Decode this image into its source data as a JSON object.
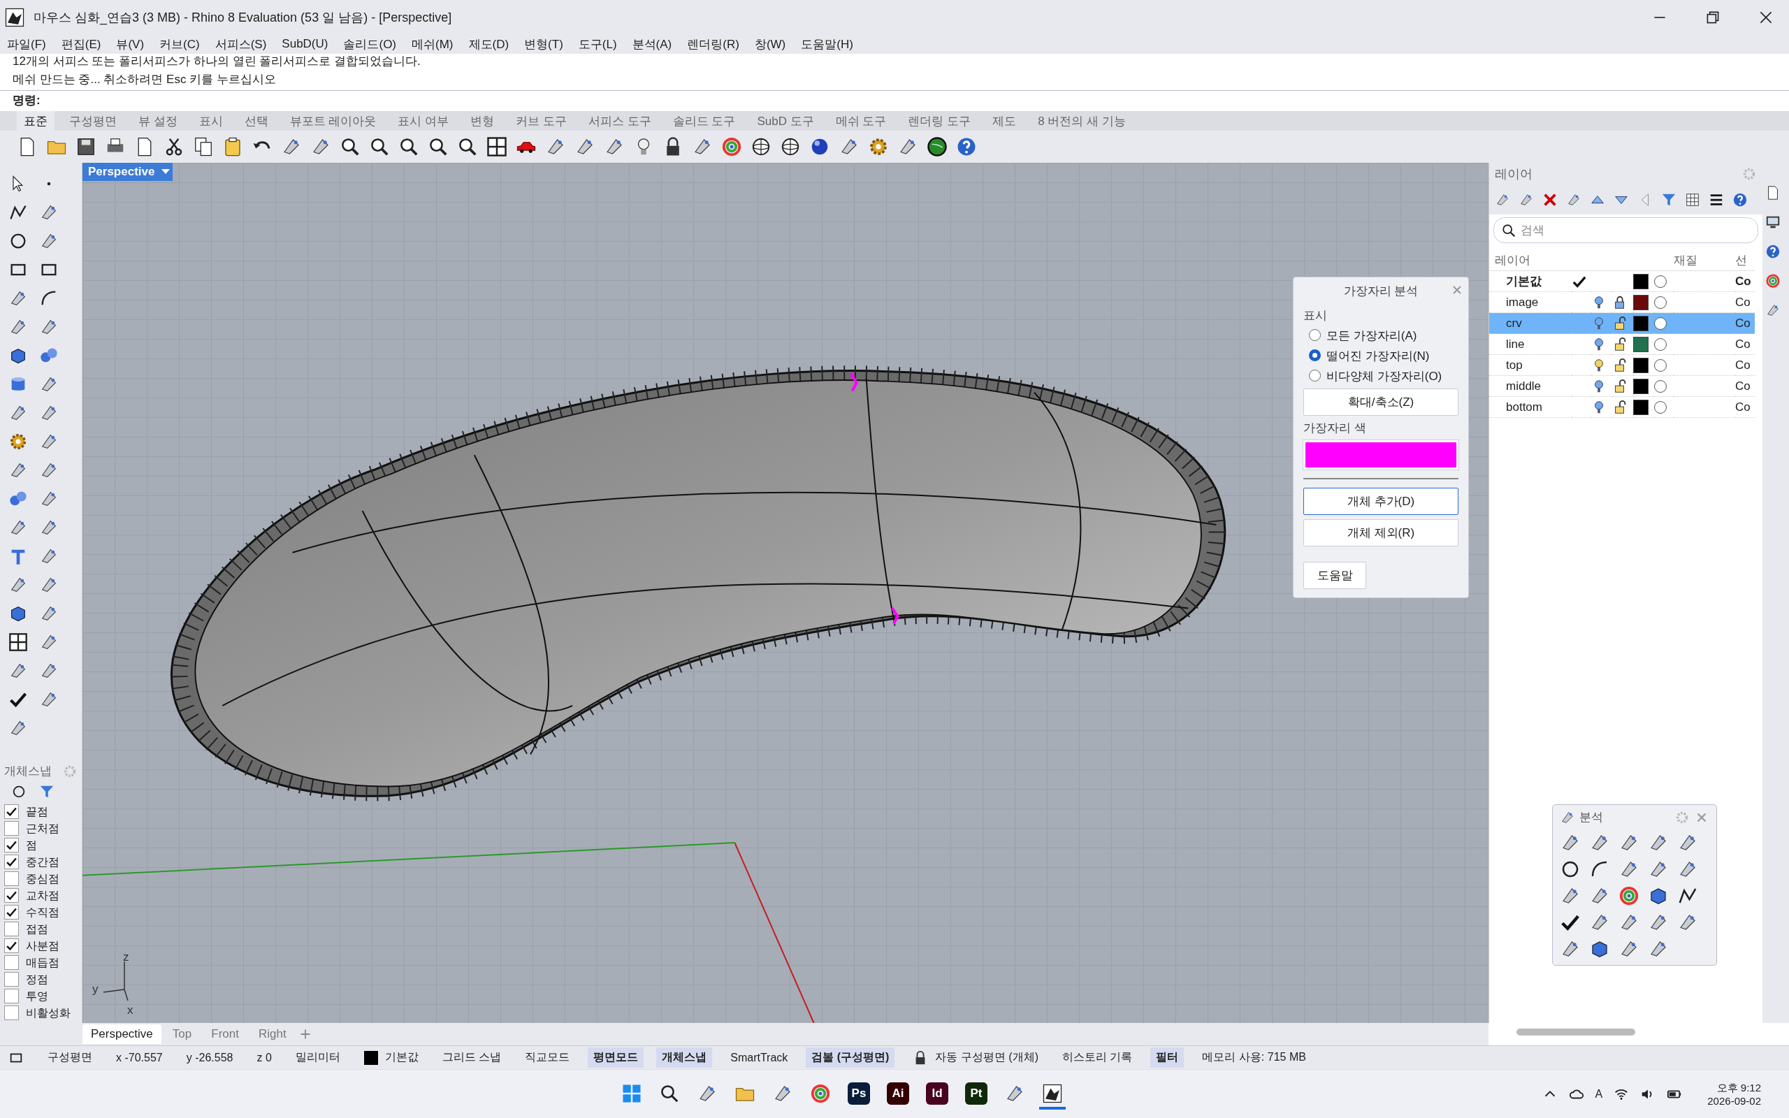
{
  "window": {
    "title": "마우스 심화_연습3 (3 MB) - Rhino 8 Evaluation (53 일 남음) - [Perspective]"
  },
  "menu": [
    "파일(F)",
    "편집(E)",
    "뷰(V)",
    "커브(C)",
    "서피스(S)",
    "SubD(U)",
    "솔리드(O)",
    "메쉬(M)",
    "제도(D)",
    "변형(T)",
    "도구(L)",
    "분석(A)",
    "렌더링(R)",
    "창(W)",
    "도움말(H)"
  ],
  "command": {
    "history": [
      "12개의 서피스 또는 폴리서피스가 하나의 열린 폴리서피스로 결합되었습니다.",
      "메쉬 만드는 중... 취소하려면 Esc 키를 누르십시오"
    ],
    "prompt": "명령:"
  },
  "toolbar_tabs": [
    {
      "label": "표준",
      "selected": true
    },
    {
      "label": "구성평면",
      "selected": false
    },
    {
      "label": "뷰 설정",
      "selected": false
    },
    {
      "label": "표시",
      "selected": false
    },
    {
      "label": "선택",
      "selected": false
    },
    {
      "label": "뷰포트 레이아웃",
      "selected": false
    },
    {
      "label": "표시 여부",
      "selected": false
    },
    {
      "label": "변형",
      "selected": false
    },
    {
      "label": "커브 도구",
      "selected": false
    },
    {
      "label": "서피스 도구",
      "selected": false
    },
    {
      "label": "솔리드 도구",
      "selected": false
    },
    {
      "label": "SubD 도구",
      "selected": false
    },
    {
      "label": "메쉬 도구",
      "selected": false
    },
    {
      "label": "렌더링 도구",
      "selected": false
    },
    {
      "label": "제도",
      "selected": false
    },
    {
      "label": "8 버전의 새 기능",
      "selected": false
    }
  ],
  "viewport": {
    "title": "Perspective",
    "axes": [
      "z",
      "y",
      "x"
    ]
  },
  "edge_analysis": {
    "title": "가장자리 분석",
    "display_label": "표시",
    "options": [
      {
        "label": "모든 가장자리(A)",
        "selected": false
      },
      {
        "label": "떨어진 가장자리(N)",
        "selected": true
      },
      {
        "label": "비다양체 가장자리(O)",
        "selected": false
      }
    ],
    "zoom_button": "확대/축소(Z)",
    "color_label": "가장자리 색",
    "color": "#ff00ff",
    "buttons": [
      "개체 추가(D)",
      "개체 제외(R)"
    ],
    "help_button": "도움말"
  },
  "snap_panel": {
    "title": "개체스냅",
    "items": [
      {
        "label": "끝점",
        "checked": true
      },
      {
        "label": "근처점",
        "checked": false
      },
      {
        "label": "점",
        "checked": true
      },
      {
        "label": "중간점",
        "checked": true
      },
      {
        "label": "중심점",
        "checked": false
      },
      {
        "label": "교차점",
        "checked": true
      },
      {
        "label": "수직점",
        "checked": true
      },
      {
        "label": "접점",
        "checked": false
      },
      {
        "label": "사분점",
        "checked": true
      },
      {
        "label": "매듭점",
        "checked": false
      },
      {
        "label": "정점",
        "checked": false
      },
      {
        "label": "투영",
        "checked": false
      },
      {
        "label": "비활성화",
        "checked": false
      }
    ]
  },
  "layers": {
    "title": "레이어",
    "search_placeholder": "검색",
    "columns": [
      "레이어",
      "재질",
      "선"
    ],
    "rows": [
      {
        "name": "기본값",
        "current": true,
        "selected": false,
        "color": "#000000",
        "linetype": "Co"
      },
      {
        "name": "image",
        "current": false,
        "selected": false,
        "light_on": false,
        "locked": true,
        "color": "#6b0a0a",
        "linetype": "Co"
      },
      {
        "name": "crv",
        "current": false,
        "selected": true,
        "light_on": false,
        "locked": false,
        "color": "#000000",
        "linetype": "Co"
      },
      {
        "name": "line",
        "current": false,
        "selected": false,
        "light_on": false,
        "locked": false,
        "color": "#21704e",
        "linetype": "Co"
      },
      {
        "name": "top",
        "current": false,
        "selected": false,
        "light_on": true,
        "locked": false,
        "color": "#000000",
        "linetype": "Co"
      },
      {
        "name": "middle",
        "current": false,
        "selected": false,
        "light_on": false,
        "locked": false,
        "color": "#000000",
        "linetype": "Co"
      },
      {
        "name": "bottom",
        "current": false,
        "selected": false,
        "light_on": false,
        "locked": false,
        "color": "#000000",
        "linetype": "Co"
      }
    ]
  },
  "analysis_toolbar": {
    "title": "분석"
  },
  "viewport_tabs": [
    {
      "label": "Perspective",
      "selected": true
    },
    {
      "label": "Top",
      "selected": false
    },
    {
      "label": "Front",
      "selected": false
    },
    {
      "label": "Right",
      "selected": false
    }
  ],
  "status_bar": [
    {
      "label": "구성평면",
      "kind": "text"
    },
    {
      "label": "x -70.557",
      "kind": "text"
    },
    {
      "label": "y -26.558",
      "kind": "text"
    },
    {
      "label": "z 0",
      "kind": "text"
    },
    {
      "label": "밀리미터",
      "kind": "text"
    },
    {
      "label": "기본값",
      "kind": "layer"
    },
    {
      "label": "그리드 스냅",
      "kind": "toggle",
      "on": false
    },
    {
      "label": "직교모드",
      "kind": "toggle",
      "on": false
    },
    {
      "label": "평면모드",
      "kind": "toggle",
      "on": true
    },
    {
      "label": "개체스냅",
      "kind": "toggle",
      "on": true
    },
    {
      "label": "SmartTrack",
      "kind": "toggle",
      "on": false
    },
    {
      "label": "검볼 (구성평면)",
      "kind": "toggle",
      "on": true
    },
    {
      "label": "자동 구성평면 (개체)",
      "kind": "lock"
    },
    {
      "label": "히스토리 기록",
      "kind": "toggle",
      "on": false
    },
    {
      "label": "필터",
      "kind": "toggle",
      "on": true
    },
    {
      "label": "메모리 사용: 715 MB",
      "kind": "text"
    }
  ],
  "taskbar": {
    "apps": [
      {
        "kind": "start",
        "selected": false
      },
      {
        "kind": "search",
        "selected": false
      },
      {
        "kind": "tool",
        "selected": false
      },
      {
        "kind": "folder",
        "selected": false
      },
      {
        "kind": "tool",
        "selected": false
      },
      {
        "kind": "wheel",
        "selected": false
      },
      {
        "kind": "badge",
        "label": "Ps",
        "color": "#0a1e3a",
        "selected": false
      },
      {
        "kind": "badge",
        "label": "Ai",
        "color": "#330000",
        "selected": false
      },
      {
        "kind": "badge",
        "label": "Id",
        "color": "#49021f",
        "selected": false
      },
      {
        "kind": "badge",
        "label": "Pt",
        "color": "#0f2a0a",
        "selected": false
      },
      {
        "kind": "tool",
        "selected": false
      },
      {
        "kind": "tool",
        "selected": true
      }
    ],
    "tray_letter": "A",
    "time": "오후 9:12",
    "date": "2026-09-02"
  }
}
